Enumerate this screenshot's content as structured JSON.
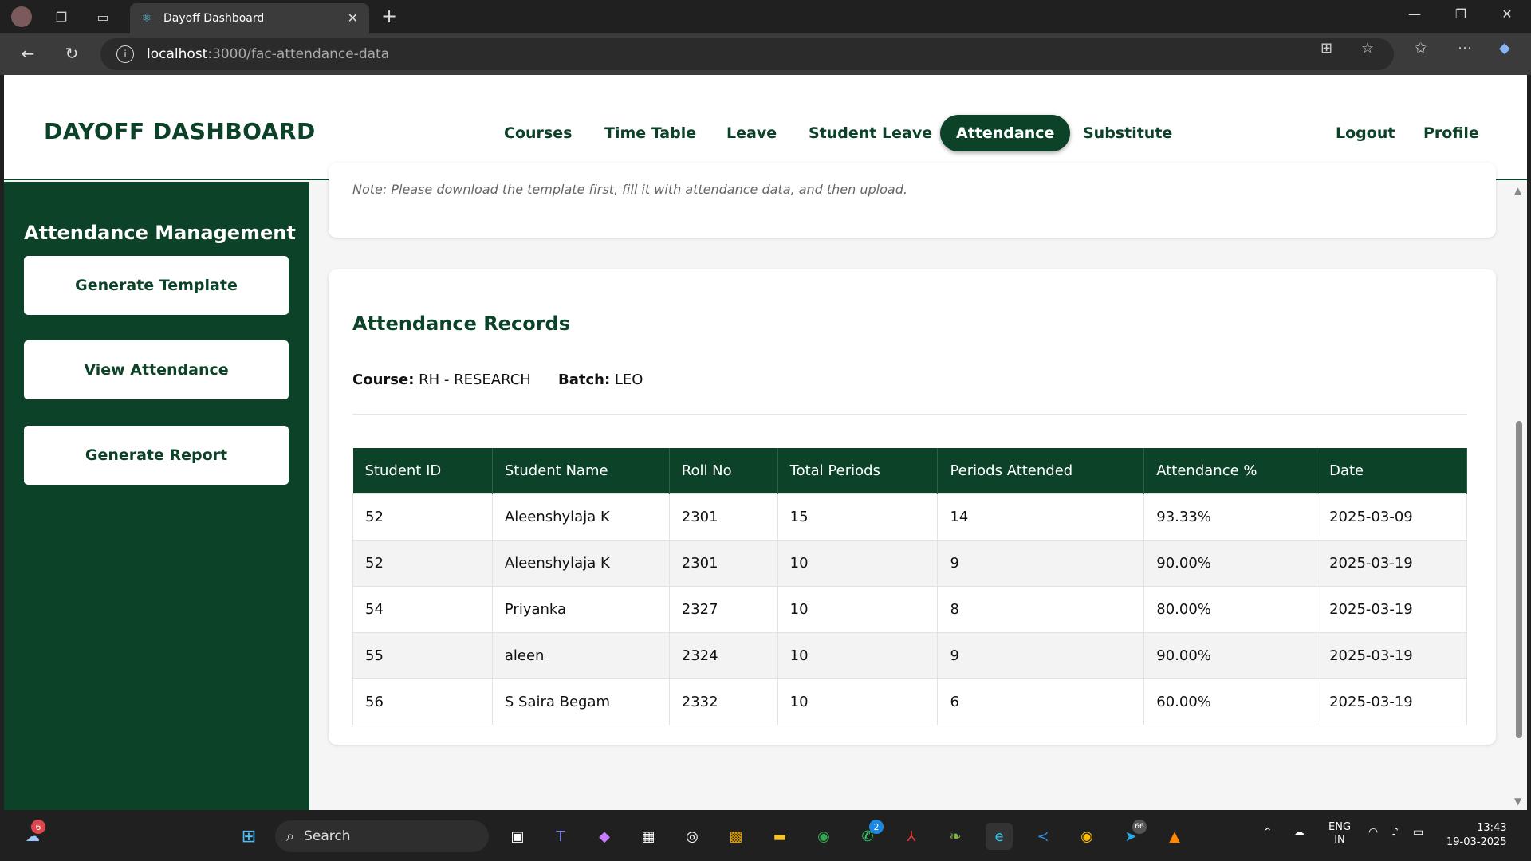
{
  "browser": {
    "tab_title": "Dayoff Dashboard",
    "url_host": "localhost",
    "url_path": ":3000/fac-attendance-data"
  },
  "header": {
    "brand": "DAYOFF DASHBOARD",
    "nav": [
      "Courses",
      "Time Table",
      "Leave",
      "Student Leave",
      "Attendance",
      "Substitute"
    ],
    "active_nav": "Attendance",
    "right_nav": [
      "Logout",
      "Profile"
    ]
  },
  "sidebar": {
    "title": "Attendance Management",
    "buttons": [
      "Generate Template",
      "View Attendance",
      "Generate Report"
    ]
  },
  "upload": {
    "note": "Note: Please download the template first, fill it with attendance data, and then upload."
  },
  "records": {
    "title": "Attendance Records",
    "course_label": "Course:",
    "course_value": "RH - RESEARCH",
    "batch_label": "Batch:",
    "batch_value": "LEO",
    "columns": [
      "Student ID",
      "Student Name",
      "Roll No",
      "Total Periods",
      "Periods Attended",
      "Attendance %",
      "Date"
    ],
    "rows": [
      [
        "52",
        "Aleenshylaja K",
        "2301",
        "15",
        "14",
        "93.33%",
        "2025-03-09"
      ],
      [
        "52",
        "Aleenshylaja K",
        "2301",
        "10",
        "9",
        "90.00%",
        "2025-03-19"
      ],
      [
        "54",
        "Priyanka",
        "2327",
        "10",
        "8",
        "80.00%",
        "2025-03-19"
      ],
      [
        "55",
        "aleen",
        "2324",
        "10",
        "9",
        "90.00%",
        "2025-03-19"
      ],
      [
        "56",
        "S Saira Begam",
        "2332",
        "10",
        "6",
        "60.00%",
        "2025-03-19"
      ]
    ]
  },
  "taskbar": {
    "search_placeholder": "Search",
    "weather_badge": "6",
    "whatsapp_badge": "2",
    "telegram_badge": "66",
    "lang_top": "ENG",
    "lang_bottom": "IN",
    "time": "13:43",
    "date": "19-03-2025"
  },
  "colors": {
    "primary": "#0b4228"
  }
}
